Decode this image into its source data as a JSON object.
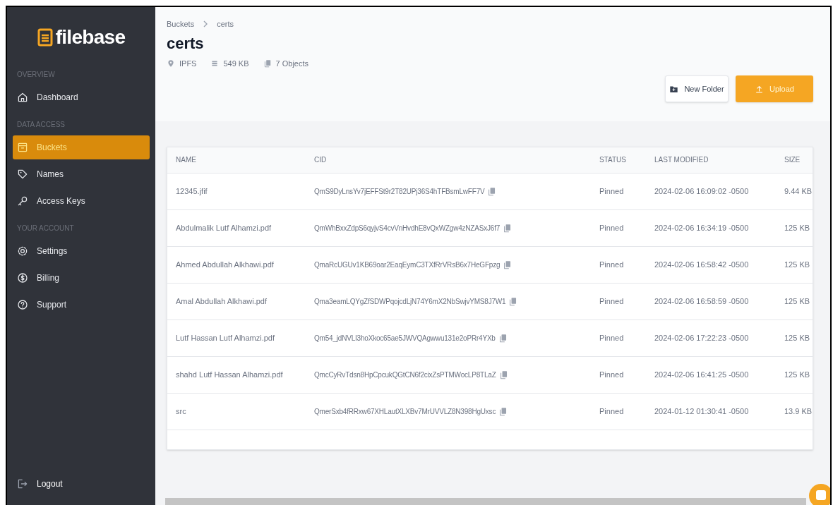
{
  "sidebar": {
    "logo": "filebase",
    "sections": [
      {
        "heading": "OVERVIEW",
        "items": [
          {
            "label": "Dashboard",
            "selected": false
          }
        ]
      },
      {
        "heading": "DATA ACCESS",
        "items": [
          {
            "label": "Buckets",
            "selected": true
          },
          {
            "label": "Names",
            "selected": false
          },
          {
            "label": "Access Keys",
            "selected": false
          }
        ]
      },
      {
        "heading": "YOUR ACCOUNT",
        "items": [
          {
            "label": "Settings",
            "selected": false
          },
          {
            "label": "Billing",
            "selected": false
          },
          {
            "label": "Support",
            "selected": false
          }
        ]
      }
    ],
    "logout": "Logout"
  },
  "breadcrumb": [
    "Buckets",
    "certs"
  ],
  "title": "certs",
  "meta": [
    {
      "text": "IPFS"
    },
    {
      "text": "549 KB"
    },
    {
      "text": "7 Objects"
    }
  ],
  "buttons": [
    {
      "label": "New Folder",
      "kind": "secondary"
    },
    {
      "label": "Upload",
      "kind": "primary"
    }
  ],
  "table": {
    "columns": [
      "NAME",
      "CID",
      "STATUS",
      "LAST MODIFIED",
      "SIZE"
    ],
    "rows": [
      {
        "name": "12345.jfif",
        "cid": "QmS9DyLnsYv7jEFFSt9r2T82UPj36S4hTFBsmLwFF7V",
        "status": "Pinned",
        "modified": "2024-02-06 16:09:02 -0500",
        "size": "9.44 KB"
      },
      {
        "name": "Abdulmalik Lutf Alhamzi.pdf",
        "cid": "QmWhBxxZdpS6qyjvS4cvVnHvdhE8vQxWZgw4zNZASxJ6f7",
        "status": "Pinned",
        "modified": "2024-02-06 16:34:19 -0500",
        "size": "125 KB"
      },
      {
        "name": "Ahmed Abdullah Alkhawi.pdf",
        "cid": "QmaRcUGUv1KB69oar2EaqEymC3TXfRrVRsB6x7HeGFpzg",
        "status": "Pinned",
        "modified": "2024-02-06 16:58:42 -0500",
        "size": "125 KB"
      },
      {
        "name": "Amal Abdullah Alkhawi.pdf",
        "cid": "Qma3eamLQYgZfSDWPqojcdLjN74Y6mX2NbSwjvYMS8J7W1",
        "status": "Pinned",
        "modified": "2024-02-06 16:58:59 -0500",
        "size": "125 KB"
      },
      {
        "name": "Lutf Hassan Lutf Alhamzi.pdf",
        "cid": "Qm54_jdNVLI3hoXkoc65ae5JWVQAgwwu131e2oPRr4YXb",
        "status": "Pinned",
        "modified": "2024-02-06 17:22:23 -0500",
        "size": "125 KB"
      },
      {
        "name": "shahd Lutf Hassan Alhamzi.pdf",
        "cid": "QmcCyRvTdsn8HpCpcukQGtCN6f2cixZsPTMWocLP8TLaZ",
        "status": "Pinned",
        "modified": "2024-02-06 16:41:25 -0500",
        "size": "125 KB"
      },
      {
        "name": "src",
        "cid": "QmerSxb4fRRxw67XHLautXLXBv7MrUVVLZ8N398HgUxsc",
        "status": "Pinned",
        "modified": "2024-01-12 01:30:41 -0500",
        "size": "13.9 KB"
      }
    ]
  }
}
